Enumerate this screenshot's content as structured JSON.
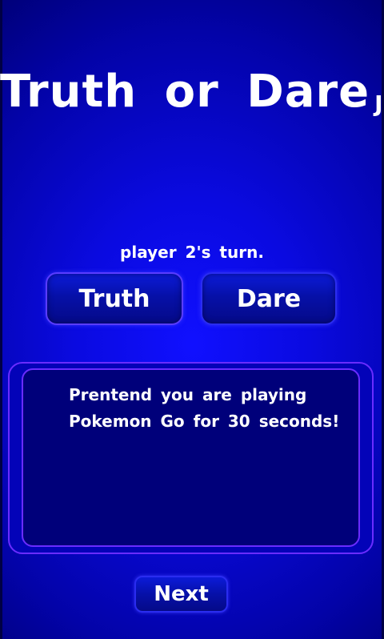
{
  "app": {
    "title_main": "Truth or Dare",
    "title_suffix": "Jr."
  },
  "turn": {
    "label": "player 2's turn."
  },
  "choices": {
    "truth_label": "Truth",
    "dare_label": "Dare"
  },
  "card": {
    "text": "Prentend you are playing Pokemon Go for 30 seconds!"
  },
  "footer": {
    "next_label": "Next"
  },
  "colors": {
    "background": "#0a0ae0",
    "button": "#0610a8",
    "card_border": "#6a2cff",
    "card_fill": "#00007a",
    "text": "#ffffff"
  }
}
